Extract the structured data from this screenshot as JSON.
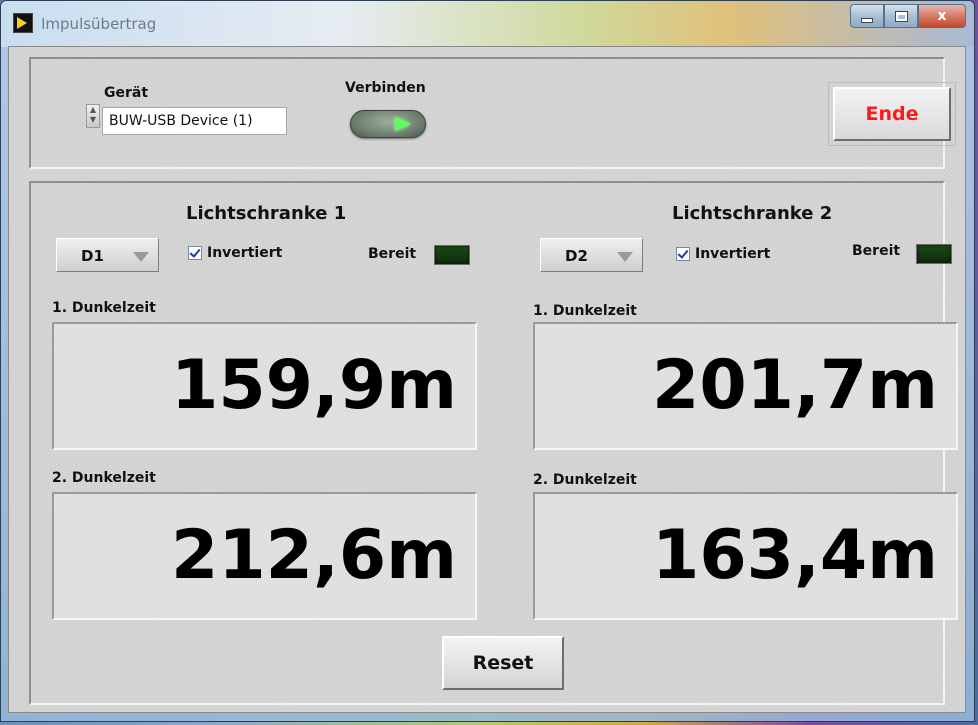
{
  "window": {
    "title": "Impulsübertrag",
    "icons": {
      "app": "labview-run-icon",
      "minimize": "minimize-icon",
      "maximize": "maximize-icon",
      "close": "close-icon"
    },
    "close_glyph": "x"
  },
  "device": {
    "label": "Gerät",
    "value": "BUW-USB Device (1)"
  },
  "connect": {
    "label": "Verbinden",
    "state": "on"
  },
  "end_button": {
    "label": "Ende",
    "color": "#ff1a1a"
  },
  "sensors": [
    {
      "title": "Lichtschranke 1",
      "channel": "D1",
      "inverted_label": "Invertiert",
      "inverted": true,
      "ready_label": "Bereit",
      "dark_time_1_label": "1. Dunkelzeit",
      "dark_time_1": "159,9m",
      "dark_time_2_label": "2. Dunkelzeit",
      "dark_time_2": "212,6m"
    },
    {
      "title": "Lichtschranke 2",
      "channel": "D2",
      "inverted_label": "Invertiert",
      "inverted": true,
      "ready_label": "Bereit",
      "dark_time_1_label": "1. Dunkelzeit",
      "dark_time_1": "201,7m",
      "dark_time_2_label": "2. Dunkelzeit",
      "dark_time_2": "163,4m"
    }
  ],
  "reset_button": {
    "label": "Reset"
  },
  "colors": {
    "led_on": "#5cff5c",
    "led_ready": "#1d4a17",
    "panel_bg": "#d6d6d6"
  }
}
